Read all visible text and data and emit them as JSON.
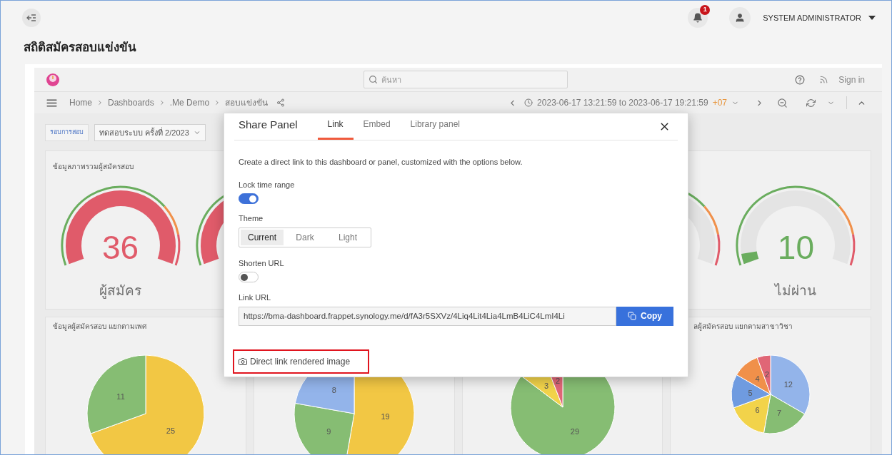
{
  "header": {
    "notification_count": "1",
    "user_name": "SYSTEM ADMINISTRATOR"
  },
  "page_title": "สถิติสมัครสอบแข่งขัน",
  "dashboard_bar": {
    "search": {
      "placeholder": "ค้นหา"
    },
    "sign_in": "Sign in",
    "breadcrumbs": [
      "Home",
      "Dashboards",
      ".Me Demo",
      "สอบแข่งขัน"
    ],
    "time_range": "2023-06-17 13:21:59 to 2023-06-17 19:21:59",
    "timezone": "+07"
  },
  "variable": {
    "label": "รอบการสอบ",
    "value": "ทดสอบระบบ ครั้งที่ 2/2023"
  },
  "overview_panel": {
    "title": "ข้อมูลภาพรวมผู้สมัครสอบ",
    "gauges": [
      {
        "kind": "gauge",
        "value": "36",
        "label": "ผู้สมัคร",
        "level": 1,
        "color": "#e05b6a"
      },
      {
        "kind": "gauge",
        "level": 1,
        "color": "#e05b6a"
      },
      {
        "kind": "gauge"
      },
      {
        "kind": "gauge",
        "value": "10",
        "label": "ไม่ผ่าน",
        "level": 0.05,
        "color": "#6aad5e"
      }
    ]
  },
  "pie_panels": [
    {
      "title": "ข้อมูลผู้สมัครสอบ แยกตามเพศ",
      "chart_data": {
        "type": "pie",
        "data_labels": true,
        "values": [
          25,
          11
        ],
        "colors": [
          "#f2c744",
          "#86bd73"
        ]
      }
    },
    {
      "chart_data": {
        "type": "pie",
        "data_labels": true,
        "values": [
          19,
          9,
          8
        ],
        "colors": [
          "#f2c744",
          "#86bd73",
          "#93b4ea"
        ]
      }
    },
    {
      "chart_data": {
        "type": "pie",
        "data_labels": true,
        "values": [
          29,
          3,
          2
        ],
        "colors": [
          "#86bd73",
          "#f2d34a",
          "#e06676"
        ]
      }
    },
    {
      "title": "ลผู้สมัครสอบ แยกตามสาขาวิชา",
      "chart_data": {
        "type": "pie",
        "data_labels": true,
        "values": [
          12,
          7,
          6,
          5,
          4,
          2
        ],
        "colors": [
          "#93b4ea",
          "#86bd73",
          "#f2d34a",
          "#6f9be0",
          "#f0904a",
          "#e06676"
        ]
      }
    }
  ],
  "share_dialog": {
    "title": "Share Panel",
    "tabs": [
      {
        "label": "Link",
        "selected": true
      },
      {
        "label": "Embed",
        "selected": false
      },
      {
        "label": "Library panel",
        "selected": false
      }
    ],
    "description": "Create a direct link to this dashboard or panel, customized with the options below.",
    "lock_time_range": {
      "label": "Lock time range",
      "on": true
    },
    "theme": {
      "label": "Theme",
      "options": [
        {
          "label": "Current",
          "selected": true
        },
        {
          "label": "Dark",
          "selected": false
        },
        {
          "label": "Light",
          "selected": false
        }
      ]
    },
    "shorten_url": {
      "label": "Shorten URL",
      "on": false
    },
    "link_url": {
      "label": "Link URL",
      "value": "https://bma-dashboard.frappet.synology.me/d/fA3r5SXVz/4Liq4Lit4Lia4LmB4LiC4LmI4Li"
    },
    "copy_button": "Copy",
    "image_link": "Direct link rendered image"
  }
}
